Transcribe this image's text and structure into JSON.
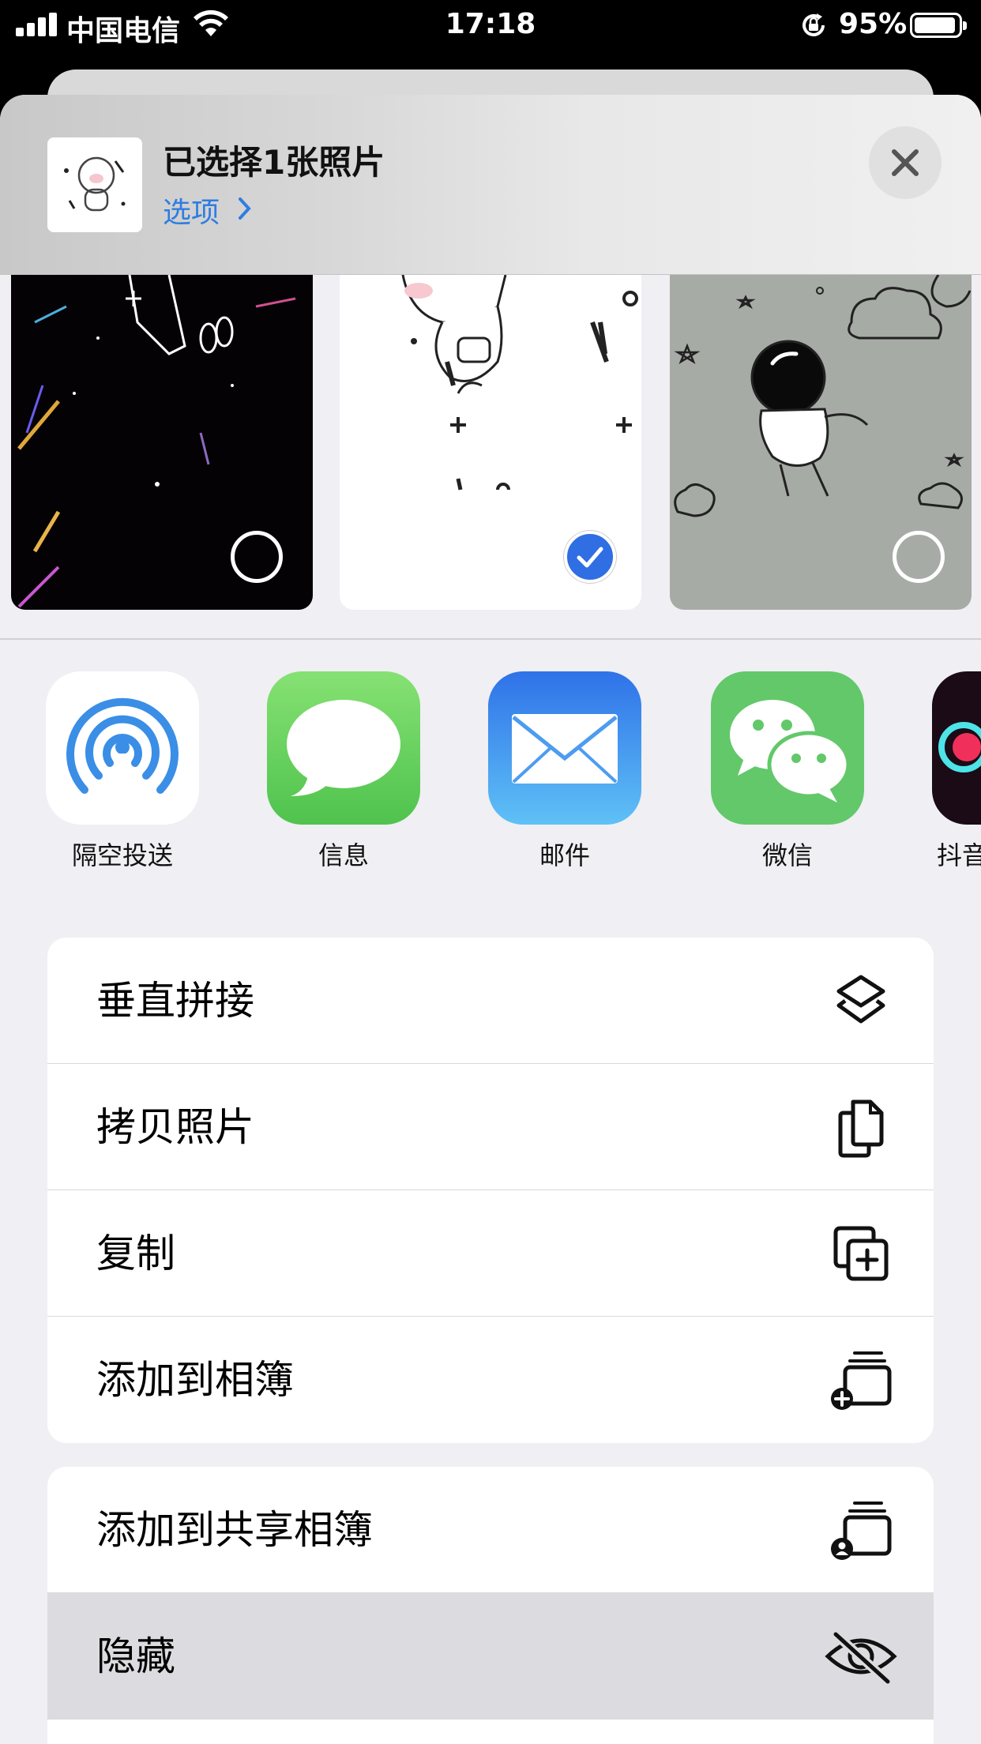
{
  "status_bar": {
    "carrier": "中国电信",
    "time": "17:18",
    "battery": "95%",
    "battery_level": 0.95
  },
  "header": {
    "title": "已选择1张照片",
    "options": "选项",
    "close_icon": "close-icon"
  },
  "photos": [
    {
      "name": "dark-space-photo",
      "selected": false
    },
    {
      "name": "pig-astronaut-photo",
      "selected": true
    },
    {
      "name": "gray-astronaut-photo",
      "selected": false
    }
  ],
  "apps": [
    {
      "label": "隔空投送",
      "icon": "airdrop-icon"
    },
    {
      "label": "信息",
      "icon": "messages-icon"
    },
    {
      "label": "邮件",
      "icon": "mail-icon"
    },
    {
      "label": "微信",
      "icon": "wechat-icon"
    },
    {
      "label": "抖音",
      "icon": "douyin-icon"
    }
  ],
  "actions_group1": [
    {
      "label": "垂直拼接",
      "icon": "shortcuts-icon"
    },
    {
      "label": "拷贝照片",
      "icon": "copy-icon"
    },
    {
      "label": "复制",
      "icon": "duplicate-icon"
    },
    {
      "label": "添加到相簿",
      "icon": "add-to-album-icon"
    }
  ],
  "actions_group2": [
    {
      "label": "添加到共享相簿",
      "icon": "shared-album-icon"
    },
    {
      "label": "隐藏",
      "icon": "hide-icon"
    }
  ],
  "colors": {
    "accent": "#2f7de1",
    "check": "#2f6ee3",
    "messages": "#5ac85a",
    "mail": "#3f8ef0",
    "wechat": "#63c86a"
  }
}
